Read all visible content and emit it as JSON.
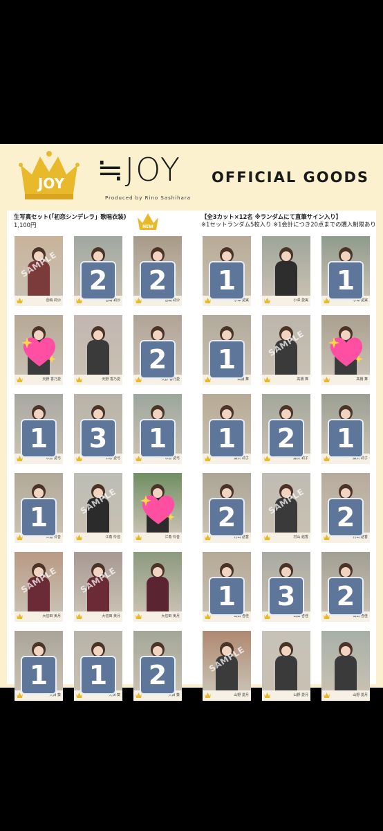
{
  "header": {
    "brand": "≒JOY",
    "brand_sub": "Produced by Rino Sashihara",
    "official": "OFFICIAL GOODS",
    "logo_text": "JOY"
  },
  "left": {
    "title": "生写真セット(「初恋シンデレラ」歌唱衣装)",
    "price": "1,100円",
    "new_badge": "NEW"
  },
  "right": {
    "line1": "【全3カット×12名 ※ランダムにて直筆サイン入り】",
    "line2": "※1セットランダム5枚入り ※1会計につき20点までの購入制限あり"
  },
  "sample_label": "SAMPLE",
  "colors": {
    "sheet": "#fbf1cf",
    "badge": "#5e769a",
    "gold": "#e9b92c",
    "heart": "#ff4fa3"
  },
  "cards": [
    {
      "name": "音嶋 莉沙",
      "bg": "#c9b39a",
      "tone": "#7b3b3b",
      "badge": "",
      "overlay": "sample"
    },
    {
      "name": "音嶋 莉沙",
      "bg": "#9fa7a0",
      "tone": "#2d2d2d",
      "badge": "2",
      "overlay": ""
    },
    {
      "name": "音嶋 莉沙",
      "bg": "#a89a88",
      "tone": "#2d2d2d",
      "badge": "2",
      "overlay": ""
    },
    {
      "name": "天野 香乃愛",
      "bg": "#b6a896",
      "tone": "#3b3b3b",
      "badge": "",
      "overlay": "heart"
    },
    {
      "name": "天野 香乃愛",
      "bg": "#c3b6b2",
      "tone": "#3a3a3a",
      "badge": "",
      "overlay": ""
    },
    {
      "name": "天野 香乃愛",
      "bg": "#b0a497",
      "tone": "#2d2d2d",
      "badge": "2",
      "overlay": ""
    },
    {
      "name": "市原 愛弓",
      "bg": "#a8a8a2",
      "tone": "#3b3b3b",
      "badge": "1",
      "overlay": ""
    },
    {
      "name": "市原 愛弓",
      "bg": "#b8b2a8",
      "tone": "#333",
      "badge": "3",
      "overlay": ""
    },
    {
      "name": "市原 愛弓",
      "bg": "#9ca79d",
      "tone": "#2d2d2d",
      "badge": "1",
      "overlay": ""
    },
    {
      "name": "江角 怜音",
      "bg": "#b1a998",
      "tone": "#3b3b3b",
      "badge": "1",
      "overlay": ""
    },
    {
      "name": "江角 怜音",
      "bg": "#bdbdb5",
      "tone": "#2b2b2b",
      "badge": "",
      "overlay": "sample"
    },
    {
      "name": "江角 怜音",
      "bg": "#6f8f62",
      "tone": "#2b2b2b",
      "badge": "",
      "overlay": "heart"
    },
    {
      "name": "大信田 美月",
      "bg": "#b99a84",
      "tone": "#6a2a36",
      "badge": "",
      "overlay": "sample"
    },
    {
      "name": "大信田 美月",
      "bg": "#a89993",
      "tone": "#6a2a36",
      "badge": "",
      "overlay": "sample"
    },
    {
      "name": "大信田 美月",
      "bg": "#8c9a7e",
      "tone": "#5a2530",
      "badge": "",
      "overlay": ""
    },
    {
      "name": "大西 葵",
      "bg": "#aaa499",
      "tone": "#3b3b3b",
      "badge": "1",
      "overlay": ""
    },
    {
      "name": "大西 葵",
      "bg": "#b7b3a8",
      "tone": "#2d2d2d",
      "badge": "1",
      "overlay": ""
    },
    {
      "name": "大西 葵",
      "bg": "#a3a798",
      "tone": "#2d2d2d",
      "badge": "2",
      "overlay": ""
    },
    {
      "name": "小澤 愛実",
      "bg": "#b8aa97",
      "tone": "#3b3b3b",
      "badge": "1",
      "overlay": ""
    },
    {
      "name": "小澤 愛実",
      "bg": "#9ea59a",
      "tone": "#2d2d2d",
      "badge": "",
      "overlay": ""
    },
    {
      "name": "小澤 愛実",
      "bg": "#8e9b8b",
      "tone": "#2d2d2d",
      "badge": "1",
      "overlay": ""
    },
    {
      "name": "髙橋 舞",
      "bg": "#b1aa9b",
      "tone": "#3b3b3b",
      "badge": "1",
      "overlay": ""
    },
    {
      "name": "髙橋 舞",
      "bg": "#bcb6ad",
      "tone": "#3a3a3a",
      "badge": "",
      "overlay": "sample"
    },
    {
      "name": "髙橋 舞",
      "bg": "#a9a090",
      "tone": "#3a3a3a",
      "badge": "",
      "overlay": "heart"
    },
    {
      "name": "藤沢 莉子",
      "bg": "#b7aa95",
      "tone": "#3b3b3b",
      "badge": "1",
      "overlay": ""
    },
    {
      "name": "藤沢 莉子",
      "bg": "#a3a79b",
      "tone": "#2d2d2d",
      "badge": "2",
      "overlay": ""
    },
    {
      "name": "藤沢 莉子",
      "bg": "#9a9f92",
      "tone": "#2d2d2d",
      "badge": "1",
      "overlay": ""
    },
    {
      "name": "村山 結香",
      "bg": "#aba596",
      "tone": "#3b3b3b",
      "badge": "2",
      "overlay": ""
    },
    {
      "name": "村山 結香",
      "bg": "#c0bcb3",
      "tone": "#3a3a3a",
      "badge": "",
      "overlay": "sample"
    },
    {
      "name": "村山 結香",
      "bg": "#b6aa9c",
      "tone": "#3a3a3a",
      "badge": "2",
      "overlay": ""
    },
    {
      "name": "山田 杏佳",
      "bg": "#b5a896",
      "tone": "#3b3b3b",
      "badge": "1",
      "overlay": ""
    },
    {
      "name": "山田 杏佳",
      "bg": "#a9a9a1",
      "tone": "#2d2d2d",
      "badge": "3",
      "overlay": ""
    },
    {
      "name": "山田 杏佳",
      "bg": "#a19f93",
      "tone": "#2d2d2d",
      "badge": "2",
      "overlay": ""
    },
    {
      "name": "山野 愛月",
      "bg": "#b08870",
      "tone": "#3b3b3b",
      "badge": "",
      "overlay": "sample"
    },
    {
      "name": "山野 愛月",
      "bg": "#c7c2b9",
      "tone": "#3a3a3a",
      "badge": "",
      "overlay": ""
    },
    {
      "name": "山野 愛月",
      "bg": "#a7b0a6",
      "tone": "#3a3a3a",
      "badge": "",
      "overlay": ""
    }
  ]
}
